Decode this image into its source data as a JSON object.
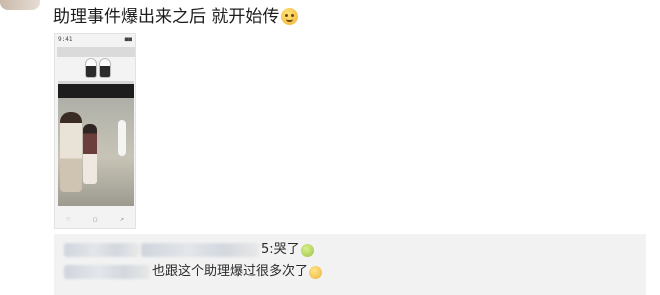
{
  "post": {
    "text": "助理事件爆出来之后 就开始传",
    "emoji": "face-emoji"
  },
  "phone_screenshot": {
    "status_time": "9:41",
    "status_battery": "■■",
    "actions": [
      "♡",
      "▢",
      "↗"
    ]
  },
  "comments": [
    {
      "suffix": "5:哭了",
      "emoji": "crying-face-emoji"
    },
    {
      "suffix": "也跟这个助理爆过很多次了",
      "emoji": "grin-face-emoji"
    }
  ]
}
